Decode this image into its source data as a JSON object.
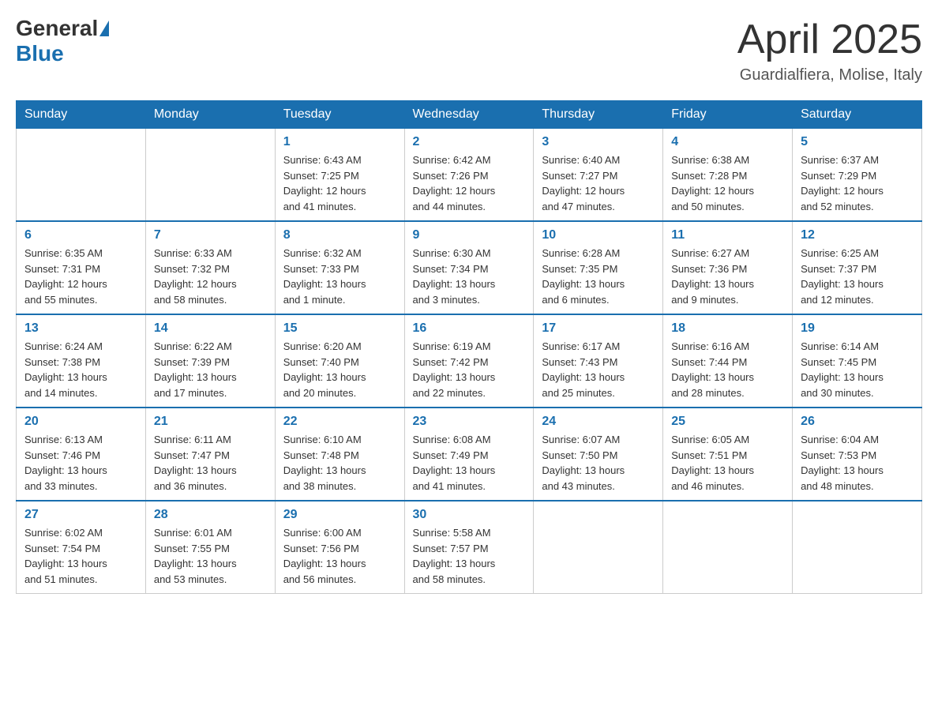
{
  "header": {
    "logo_general": "General",
    "logo_blue": "Blue",
    "month_title": "April 2025",
    "subtitle": "Guardialfiera, Molise, Italy"
  },
  "weekdays": [
    "Sunday",
    "Monday",
    "Tuesday",
    "Wednesday",
    "Thursday",
    "Friday",
    "Saturday"
  ],
  "weeks": [
    [
      {
        "day": "",
        "info": ""
      },
      {
        "day": "",
        "info": ""
      },
      {
        "day": "1",
        "info": "Sunrise: 6:43 AM\nSunset: 7:25 PM\nDaylight: 12 hours\nand 41 minutes."
      },
      {
        "day": "2",
        "info": "Sunrise: 6:42 AM\nSunset: 7:26 PM\nDaylight: 12 hours\nand 44 minutes."
      },
      {
        "day": "3",
        "info": "Sunrise: 6:40 AM\nSunset: 7:27 PM\nDaylight: 12 hours\nand 47 minutes."
      },
      {
        "day": "4",
        "info": "Sunrise: 6:38 AM\nSunset: 7:28 PM\nDaylight: 12 hours\nand 50 minutes."
      },
      {
        "day": "5",
        "info": "Sunrise: 6:37 AM\nSunset: 7:29 PM\nDaylight: 12 hours\nand 52 minutes."
      }
    ],
    [
      {
        "day": "6",
        "info": "Sunrise: 6:35 AM\nSunset: 7:31 PM\nDaylight: 12 hours\nand 55 minutes."
      },
      {
        "day": "7",
        "info": "Sunrise: 6:33 AM\nSunset: 7:32 PM\nDaylight: 12 hours\nand 58 minutes."
      },
      {
        "day": "8",
        "info": "Sunrise: 6:32 AM\nSunset: 7:33 PM\nDaylight: 13 hours\nand 1 minute."
      },
      {
        "day": "9",
        "info": "Sunrise: 6:30 AM\nSunset: 7:34 PM\nDaylight: 13 hours\nand 3 minutes."
      },
      {
        "day": "10",
        "info": "Sunrise: 6:28 AM\nSunset: 7:35 PM\nDaylight: 13 hours\nand 6 minutes."
      },
      {
        "day": "11",
        "info": "Sunrise: 6:27 AM\nSunset: 7:36 PM\nDaylight: 13 hours\nand 9 minutes."
      },
      {
        "day": "12",
        "info": "Sunrise: 6:25 AM\nSunset: 7:37 PM\nDaylight: 13 hours\nand 12 minutes."
      }
    ],
    [
      {
        "day": "13",
        "info": "Sunrise: 6:24 AM\nSunset: 7:38 PM\nDaylight: 13 hours\nand 14 minutes."
      },
      {
        "day": "14",
        "info": "Sunrise: 6:22 AM\nSunset: 7:39 PM\nDaylight: 13 hours\nand 17 minutes."
      },
      {
        "day": "15",
        "info": "Sunrise: 6:20 AM\nSunset: 7:40 PM\nDaylight: 13 hours\nand 20 minutes."
      },
      {
        "day": "16",
        "info": "Sunrise: 6:19 AM\nSunset: 7:42 PM\nDaylight: 13 hours\nand 22 minutes."
      },
      {
        "day": "17",
        "info": "Sunrise: 6:17 AM\nSunset: 7:43 PM\nDaylight: 13 hours\nand 25 minutes."
      },
      {
        "day": "18",
        "info": "Sunrise: 6:16 AM\nSunset: 7:44 PM\nDaylight: 13 hours\nand 28 minutes."
      },
      {
        "day": "19",
        "info": "Sunrise: 6:14 AM\nSunset: 7:45 PM\nDaylight: 13 hours\nand 30 minutes."
      }
    ],
    [
      {
        "day": "20",
        "info": "Sunrise: 6:13 AM\nSunset: 7:46 PM\nDaylight: 13 hours\nand 33 minutes."
      },
      {
        "day": "21",
        "info": "Sunrise: 6:11 AM\nSunset: 7:47 PM\nDaylight: 13 hours\nand 36 minutes."
      },
      {
        "day": "22",
        "info": "Sunrise: 6:10 AM\nSunset: 7:48 PM\nDaylight: 13 hours\nand 38 minutes."
      },
      {
        "day": "23",
        "info": "Sunrise: 6:08 AM\nSunset: 7:49 PM\nDaylight: 13 hours\nand 41 minutes."
      },
      {
        "day": "24",
        "info": "Sunrise: 6:07 AM\nSunset: 7:50 PM\nDaylight: 13 hours\nand 43 minutes."
      },
      {
        "day": "25",
        "info": "Sunrise: 6:05 AM\nSunset: 7:51 PM\nDaylight: 13 hours\nand 46 minutes."
      },
      {
        "day": "26",
        "info": "Sunrise: 6:04 AM\nSunset: 7:53 PM\nDaylight: 13 hours\nand 48 minutes."
      }
    ],
    [
      {
        "day": "27",
        "info": "Sunrise: 6:02 AM\nSunset: 7:54 PM\nDaylight: 13 hours\nand 51 minutes."
      },
      {
        "day": "28",
        "info": "Sunrise: 6:01 AM\nSunset: 7:55 PM\nDaylight: 13 hours\nand 53 minutes."
      },
      {
        "day": "29",
        "info": "Sunrise: 6:00 AM\nSunset: 7:56 PM\nDaylight: 13 hours\nand 56 minutes."
      },
      {
        "day": "30",
        "info": "Sunrise: 5:58 AM\nSunset: 7:57 PM\nDaylight: 13 hours\nand 58 minutes."
      },
      {
        "day": "",
        "info": ""
      },
      {
        "day": "",
        "info": ""
      },
      {
        "day": "",
        "info": ""
      }
    ]
  ]
}
